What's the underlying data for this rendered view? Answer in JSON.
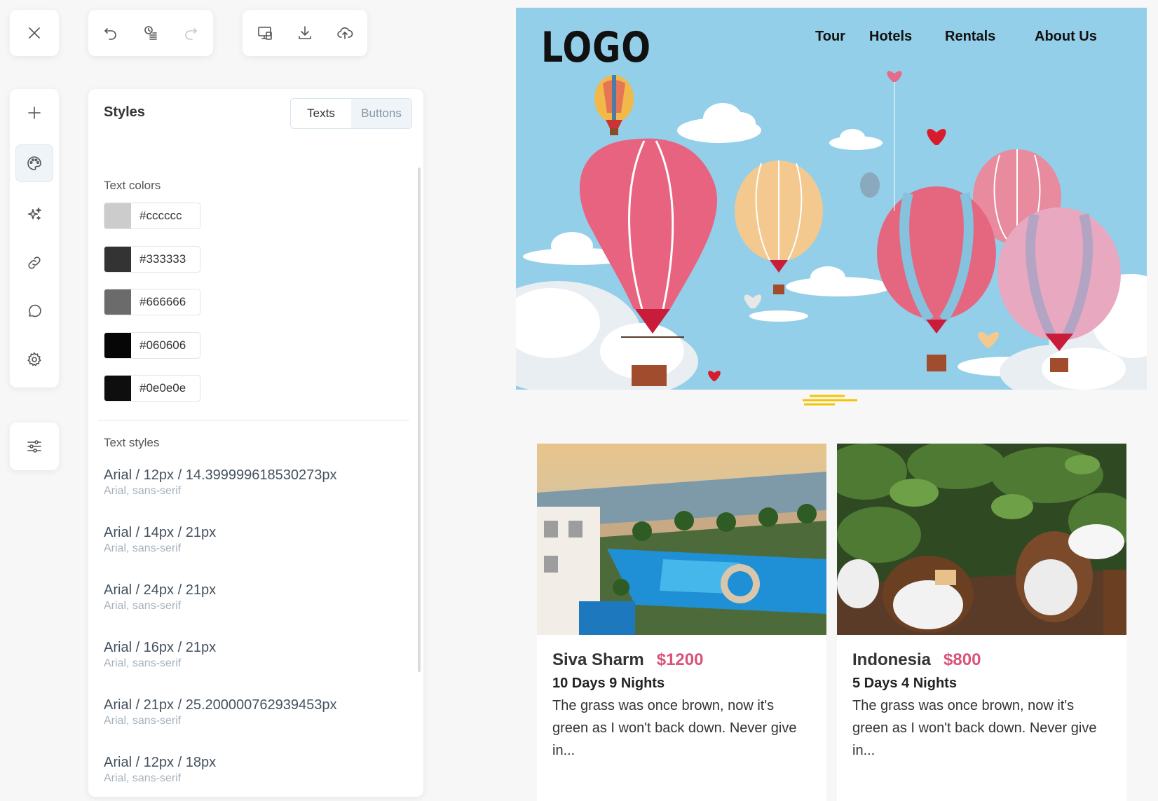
{
  "toolbar": {
    "close": "close-icon",
    "history": [
      "undo-icon",
      "history-icon",
      "redo-icon"
    ],
    "actions": [
      "preview-icon",
      "download-icon",
      "upload-icon"
    ]
  },
  "sidebar": {
    "items": [
      "add-icon",
      "palette-icon",
      "sparkle-icon",
      "link-icon",
      "chat-icon",
      "settings-icon"
    ],
    "extra": "sliders-icon",
    "active": "palette-icon"
  },
  "styles_panel": {
    "title": "Styles",
    "tabs": [
      {
        "label": "Texts",
        "active": true
      },
      {
        "label": "Buttons",
        "active": false
      }
    ],
    "text_colors_label": "Text colors",
    "text_colors": [
      {
        "hex": "#cccccc",
        "color": "#cccccc"
      },
      {
        "hex": "#333333",
        "color": "#333333"
      },
      {
        "hex": "#666666",
        "color": "#6b6b6b"
      },
      {
        "hex": "#060606",
        "color": "#060606"
      },
      {
        "hex": "#0e0e0e",
        "color": "#0e0e0e"
      }
    ],
    "text_styles_label": "Text styles",
    "text_styles": [
      {
        "main": "Arial / 12px / 14.399999618530273px",
        "sub": "Arial, sans-serif"
      },
      {
        "main": "Arial / 14px / 21px",
        "sub": "Arial, sans-serif"
      },
      {
        "main": "Arial / 24px / 21px",
        "sub": "Arial, sans-serif"
      },
      {
        "main": "Arial / 16px / 21px",
        "sub": "Arial, sans-serif"
      },
      {
        "main": "Arial / 21px / 25.200000762939453px",
        "sub": "Arial, sans-serif"
      },
      {
        "main": "Arial / 12px / 18px",
        "sub": "Arial, sans-serif"
      }
    ]
  },
  "preview": {
    "logo": "LOGO",
    "nav": [
      "Tour",
      "Hotels",
      "Rentals",
      "About Us"
    ],
    "colors": {
      "sky": "#93cfe8",
      "price": "#d9537a"
    },
    "tours": [
      {
        "title": "Siva Sharm",
        "price": "$1200",
        "duration": "10 Days 9 Nights",
        "description": "The grass was once brown, now it's green as I won't back down. Never give in..."
      },
      {
        "title": "Indonesia",
        "price": "$800",
        "duration": "5 Days 4 Nights",
        "description": "The grass was once brown, now it's green as I won't back down. Never give in..."
      }
    ]
  }
}
